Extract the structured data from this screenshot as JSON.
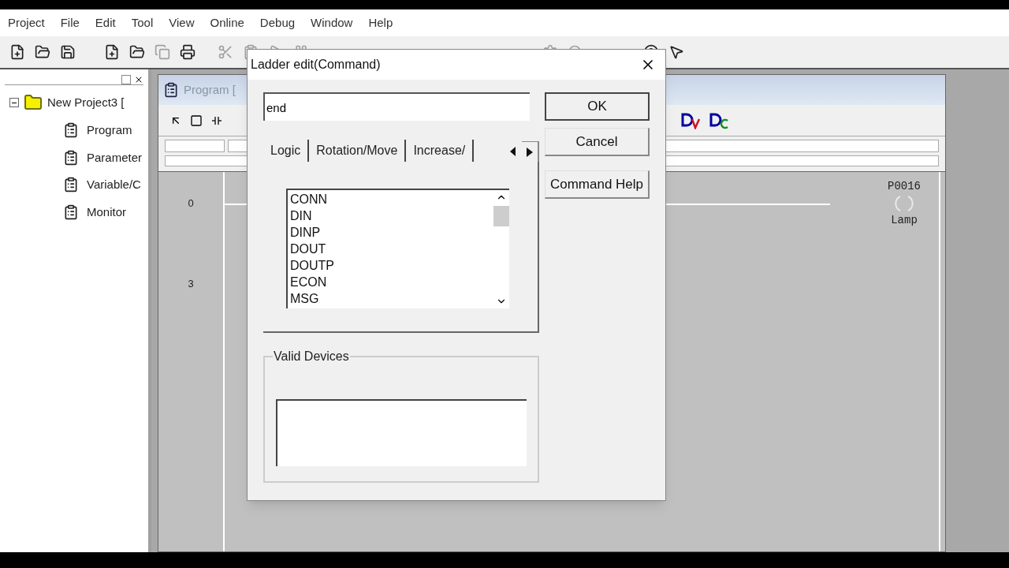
{
  "menu": [
    {
      "label": "Project"
    },
    {
      "label": "File"
    },
    {
      "label": "Edit"
    },
    {
      "label": "Tool"
    },
    {
      "label": "View"
    },
    {
      "label": "Online"
    },
    {
      "label": "Debug"
    },
    {
      "label": "Window"
    },
    {
      "label": "Help"
    }
  ],
  "project_tree": {
    "root": {
      "label": "New Project3 [",
      "expanded": true,
      "children": [
        {
          "label": "Program"
        },
        {
          "label": "Parameter"
        },
        {
          "label": "Variable/C"
        },
        {
          "label": "Monitor"
        }
      ]
    }
  },
  "program_window": {
    "title": "Program [",
    "ladder": {
      "step_numbers": [
        "0",
        "3"
      ],
      "coil": {
        "address": "P0016",
        "comment": "Lamp"
      }
    }
  },
  "dialog": {
    "title": "Ladder edit(Command)",
    "command_field": {
      "value": "end"
    },
    "tabs": [
      {
        "label": "Logic"
      },
      {
        "label": "Rotation/Move"
      },
      {
        "label": "Increase/"
      }
    ],
    "commands": [
      {
        "label": "CONN"
      },
      {
        "label": "DIN"
      },
      {
        "label": "DINP"
      },
      {
        "label": "DOUT"
      },
      {
        "label": "DOUTP"
      },
      {
        "label": "ECON"
      },
      {
        "label": "MSG"
      }
    ],
    "buttons": [
      {
        "label": "OK",
        "default": true
      },
      {
        "label": "Cancel",
        "default": false
      },
      {
        "label": "Command Help",
        "default": false
      }
    ],
    "valid_devices": {
      "title": "Valid Devices"
    }
  }
}
